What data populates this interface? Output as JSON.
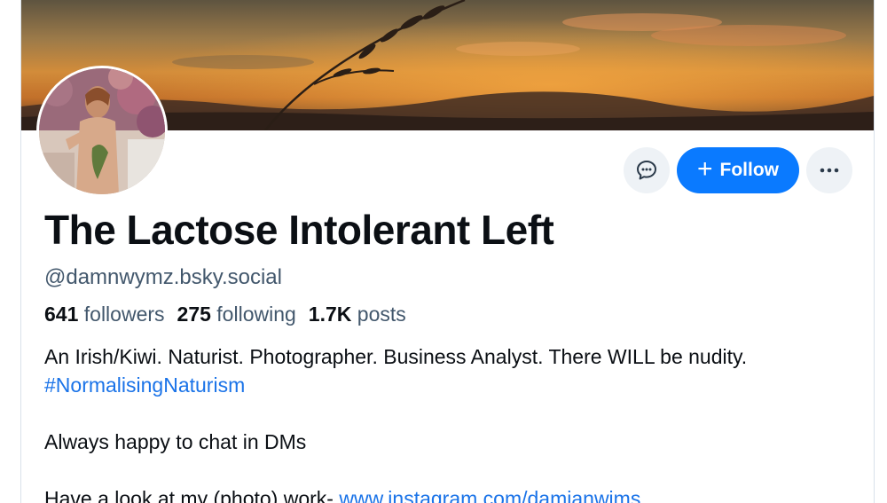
{
  "profile": {
    "display_name": "The Lactose Intolerant Left",
    "handle": "@damnwymz.bsky.social",
    "stats": {
      "followers_count": "641",
      "followers_label": "followers",
      "following_count": "275",
      "following_label": "following",
      "posts_count": "1.7K",
      "posts_label": "posts"
    },
    "bio": {
      "line1": "An Irish/Kiwi. Naturist. Photographer. Business Analyst. There WILL be nudity.",
      "hashtag": "#NormalisingNaturism",
      "line3": "Always happy to chat in DMs",
      "line4_prefix": "Have a look at my (photo) work- ",
      "line4_link": "www.instagram.com/damianwims"
    }
  },
  "actions": {
    "message_icon": "chat-bubble-icon",
    "follow_label": "Follow",
    "follow_icon": "plus-icon",
    "more_icon": "ellipsis-icon"
  },
  "colors": {
    "accent": "#0a7aff",
    "link": "#1a73e8",
    "muted_text": "#42576c",
    "primary_text": "#0b0f14",
    "icon_button_bg": "#eef2f6"
  }
}
